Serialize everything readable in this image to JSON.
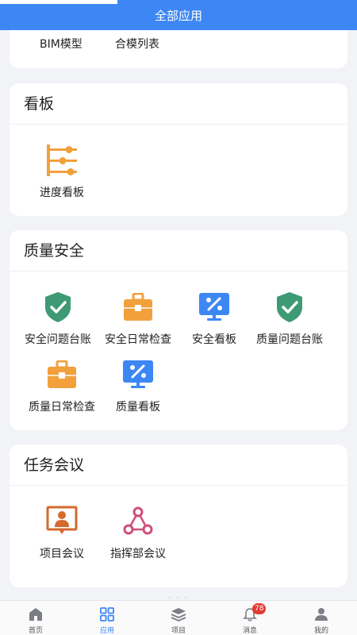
{
  "header": {
    "title": "全部应用"
  },
  "top_card": {
    "items": [
      {
        "label": "BIM模型"
      },
      {
        "label": "合模列表"
      }
    ]
  },
  "kanban": {
    "title": "看板",
    "items": [
      {
        "label": "进度看板",
        "icon": "progress-kanban-icon"
      }
    ]
  },
  "quality_safety": {
    "title": "质量安全",
    "items": [
      {
        "label": "安全问题台账",
        "icon": "shield-check-icon"
      },
      {
        "label": "安全日常检查",
        "icon": "toolbox-icon"
      },
      {
        "label": "安全看板",
        "icon": "monitor-percent-icon"
      },
      {
        "label": "质量问题台账",
        "icon": "shield-check-icon"
      },
      {
        "label": "质量日常检查",
        "icon": "toolbox-icon"
      },
      {
        "label": "质量看板",
        "icon": "monitor-percent-icon"
      }
    ]
  },
  "task_meeting": {
    "title": "任务会议",
    "items": [
      {
        "label": "项目会议",
        "icon": "meeting-presenter-icon"
      },
      {
        "label": "指挥部会议",
        "icon": "network-nodes-icon"
      }
    ]
  },
  "tabbar": {
    "items": [
      {
        "label": "首页",
        "icon": "home-icon"
      },
      {
        "label": "应用",
        "icon": "apps-grid-icon",
        "active": true
      },
      {
        "label": "项目",
        "icon": "layers-icon"
      },
      {
        "label": "消息",
        "icon": "bell-icon",
        "badge": "78"
      },
      {
        "label": "我的",
        "icon": "user-icon"
      }
    ]
  },
  "colors": {
    "primary": "#3d87f5",
    "green": "#3e9a74",
    "orange": "#f2a03c",
    "blue": "#3d87f5",
    "brown": "#d46a2e",
    "pink": "#cf4f77",
    "badge": "#e53935"
  }
}
